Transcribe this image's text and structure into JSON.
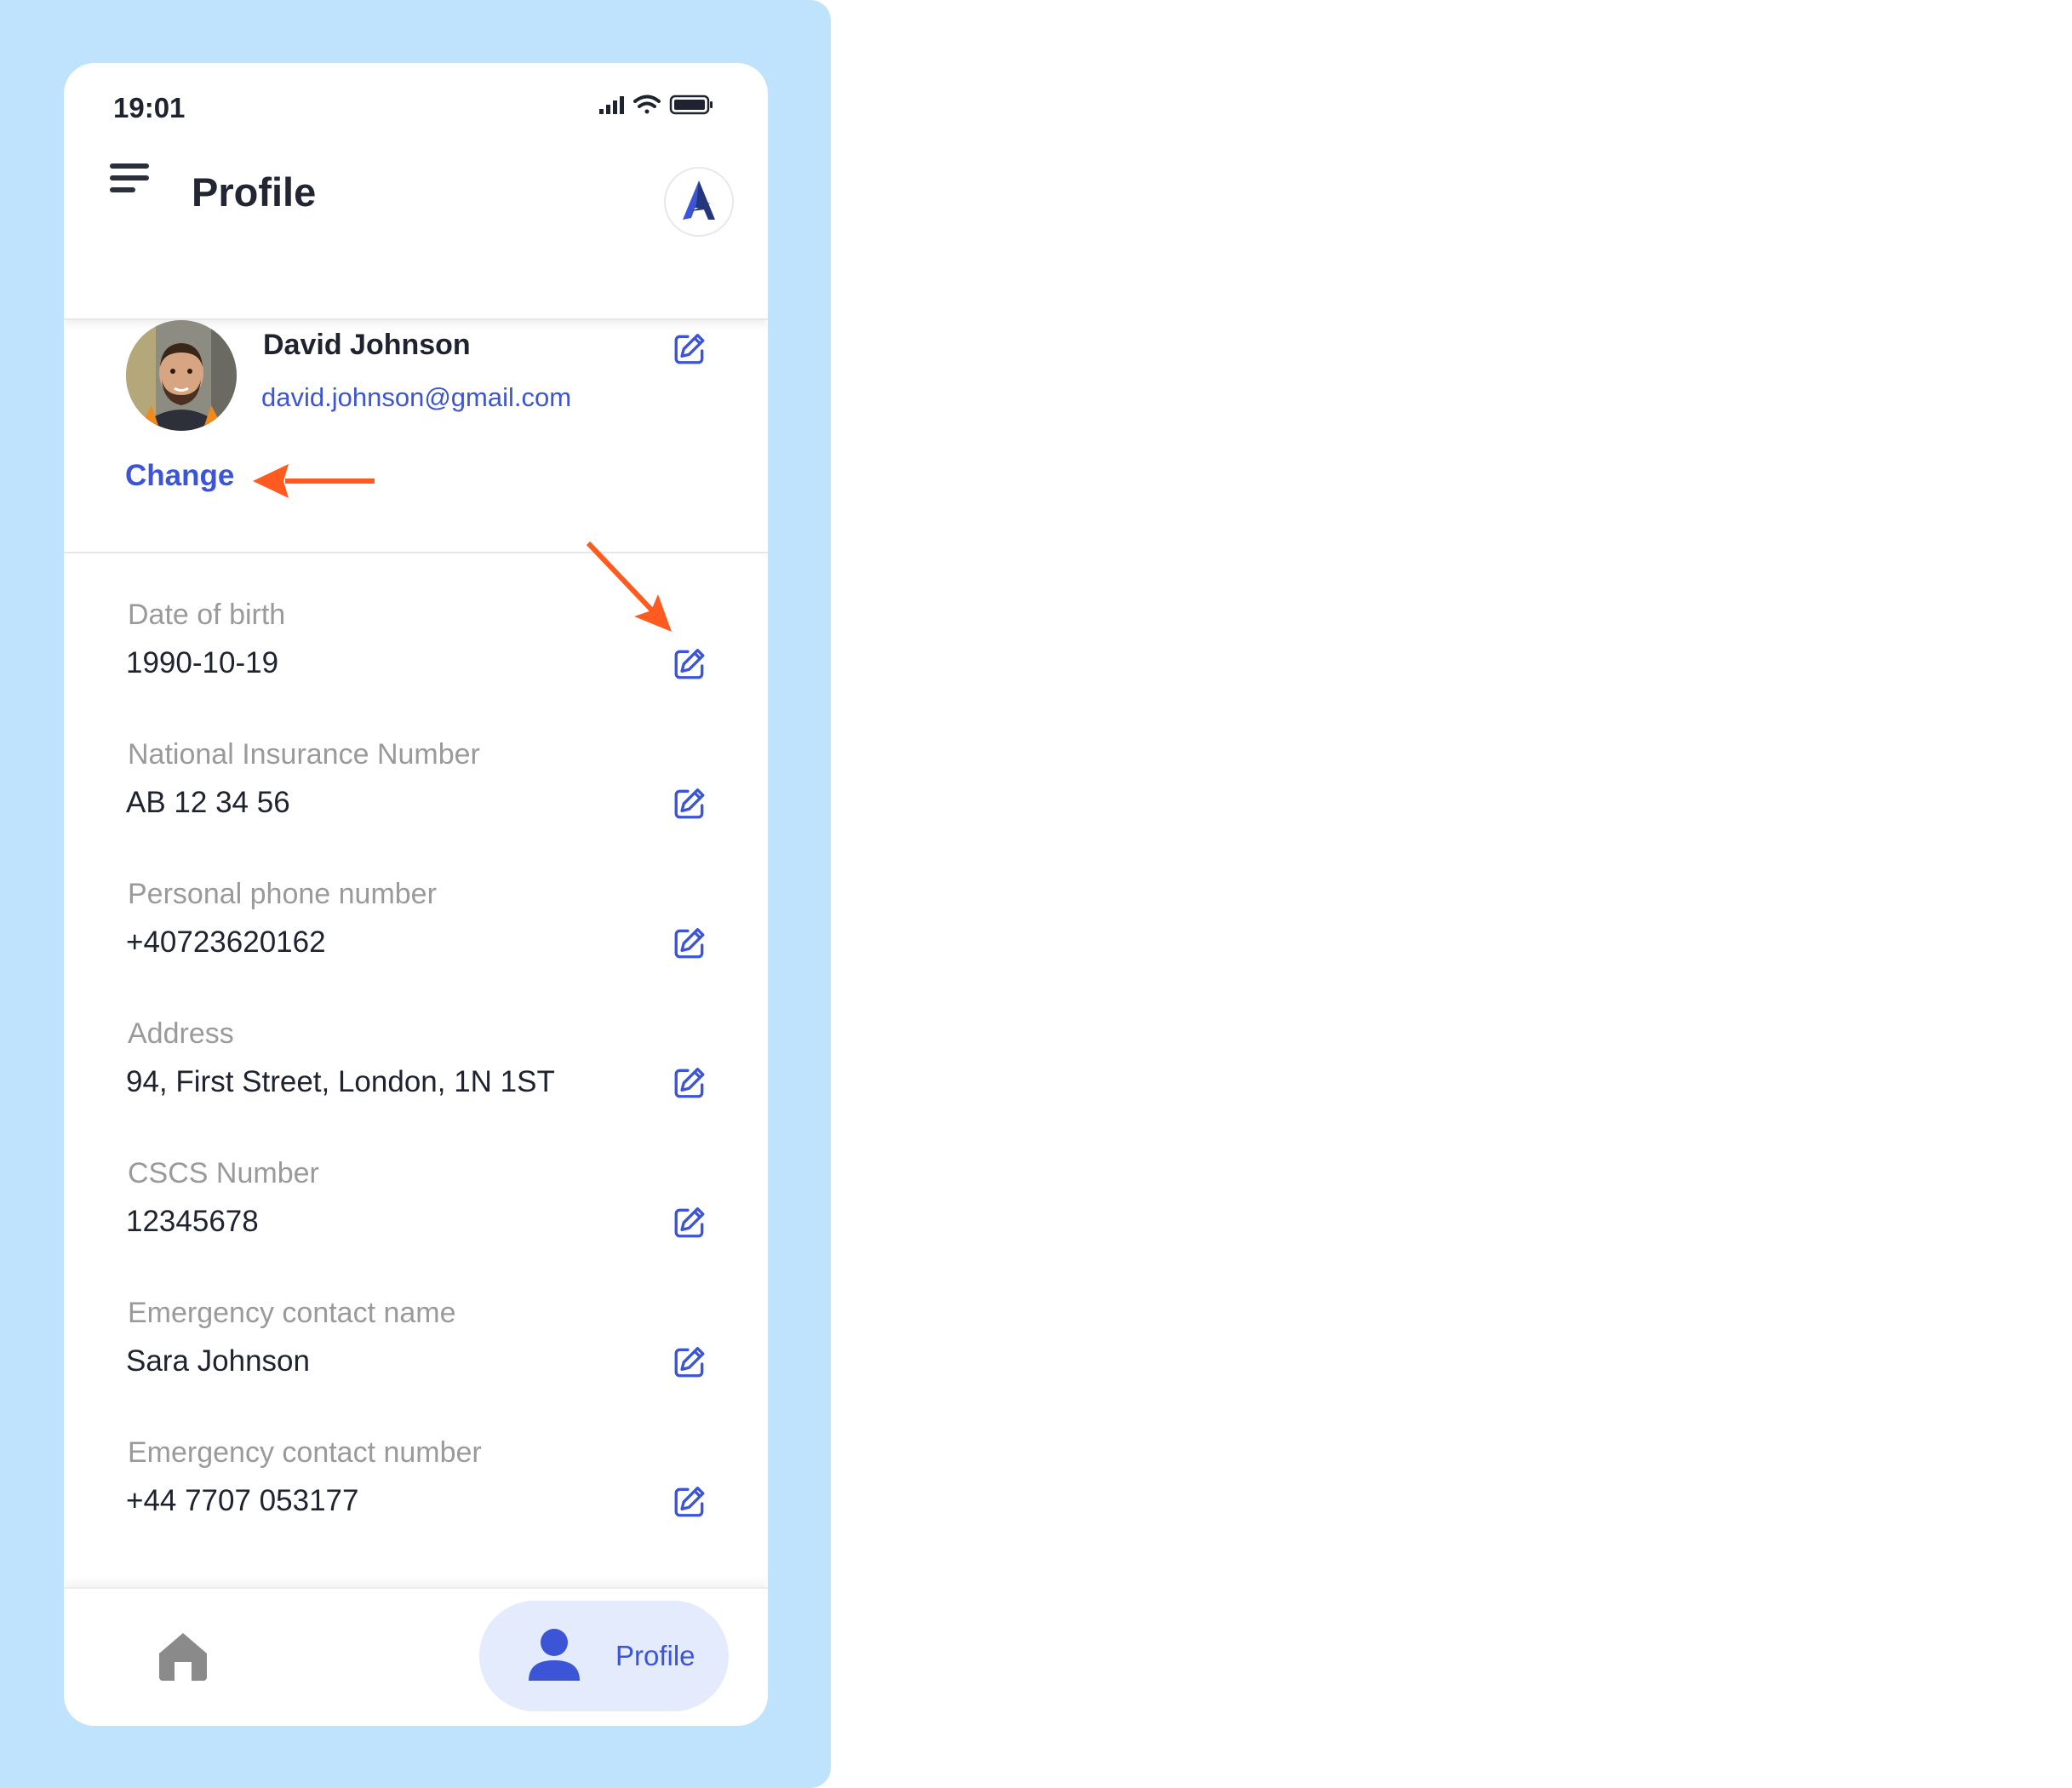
{
  "status_bar": {
    "time": "19:01",
    "icons": [
      "signal-icon",
      "wifi-icon",
      "battery-icon"
    ]
  },
  "header": {
    "title": "Profile",
    "menu_icon": "hamburger-menu-icon",
    "logo_icon": "app-logo-icon"
  },
  "profile": {
    "name": "David Johnson",
    "email": "david.johnson@gmail.com",
    "change_label": "Change"
  },
  "fields": [
    {
      "label": "Date of birth",
      "value": "1990-10-19"
    },
    {
      "label": "National Insurance Number",
      "value": "AB 12 34 56"
    },
    {
      "label": "Personal phone number",
      "value": "+40723620162"
    },
    {
      "label": "Address",
      "value": "94, First Street, London, 1N 1ST"
    },
    {
      "label": "CSCS Number",
      "value": "12345678"
    },
    {
      "label": "Emergency contact name",
      "value": "Sara Johnson"
    },
    {
      "label": "Emergency contact number",
      "value": "+44 7707 053177"
    }
  ],
  "bottom_nav": {
    "home_icon": "home-icon",
    "profile_icon": "user-icon",
    "profile_label": "Profile"
  },
  "colors": {
    "accent": "#3c55d6",
    "annotation_arrow": "#ff5a1f",
    "backdrop": "#bfe3fc",
    "active_tab_bg": "#e3ebfc"
  }
}
